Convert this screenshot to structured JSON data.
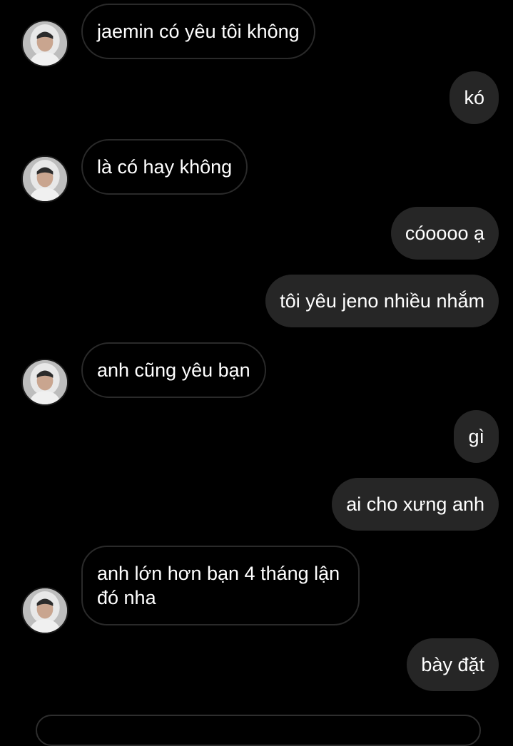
{
  "thread": {
    "messages": [
      {
        "side": "in",
        "text": "jaemin có yêu tôi không"
      },
      {
        "side": "out",
        "text": "kó"
      },
      {
        "side": "in",
        "text": "là có hay không"
      },
      {
        "side": "out",
        "text": "cóoooo ạ"
      },
      {
        "side": "out",
        "text": "tôi yêu jeno nhiều nhắm"
      },
      {
        "side": "in",
        "text": "anh cũng yêu bạn"
      },
      {
        "side": "out",
        "text": "gì"
      },
      {
        "side": "out",
        "text": "ai cho xưng anh"
      },
      {
        "side": "in",
        "text": "anh lớn hơn bạn 4 tháng lận đó nha"
      },
      {
        "side": "out",
        "text": "bày đặt"
      }
    ]
  },
  "colors": {
    "background": "#000000",
    "incoming_bubble_border": "#2a2a2a",
    "outgoing_bubble": "#262626",
    "text": "#ffffff"
  },
  "icons": {
    "avatar": "contact-avatar-photo"
  }
}
